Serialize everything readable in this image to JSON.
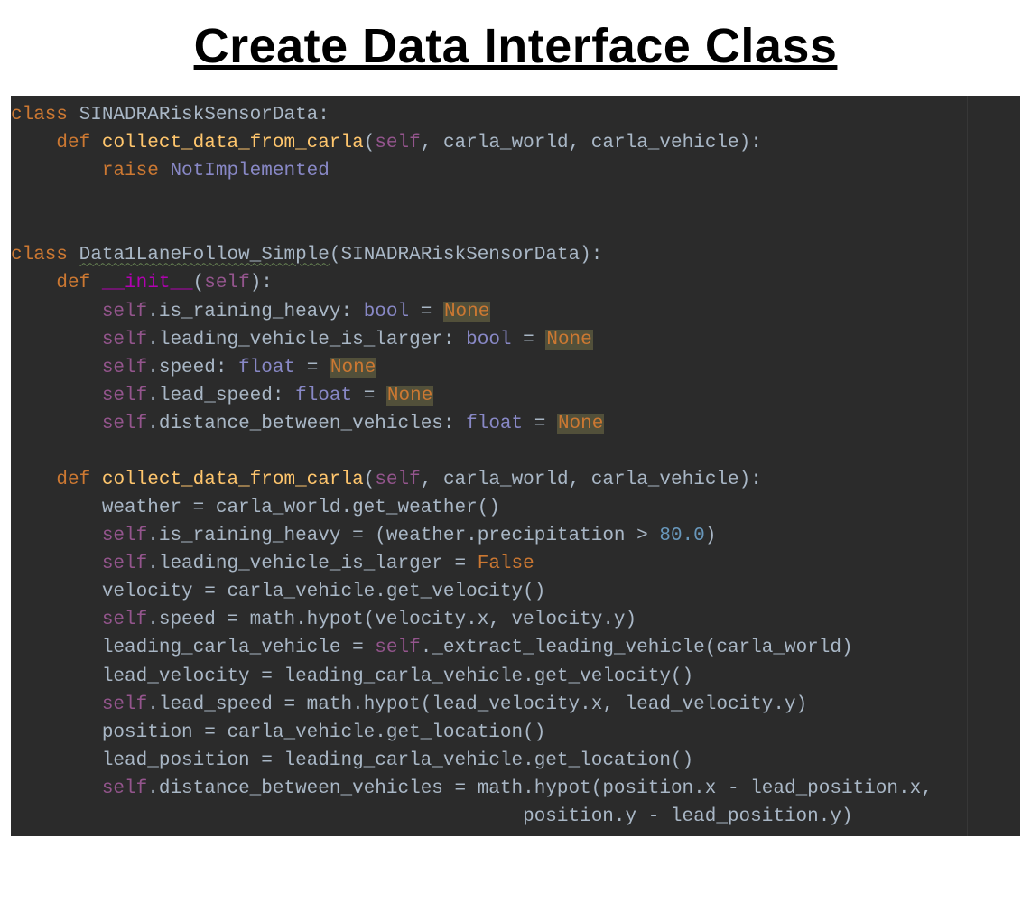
{
  "heading": "Create Data Interface Class",
  "code": {
    "line1": {
      "kw_class": "class",
      "name": "SINADRARiskSensorData",
      "colon": ":"
    },
    "line2": {
      "kw_def": "def",
      "fn": "collect_data_from_carla",
      "p1": "self",
      "p2": "carla_world",
      "p3": "carla_vehicle"
    },
    "line3": {
      "kw_raise": "raise",
      "exc": "NotImplemented"
    },
    "line6": {
      "kw_class": "class",
      "name": "Data1LaneFollow_Simple",
      "base": "SINADRARiskSensorData"
    },
    "line7": {
      "kw_def": "def",
      "fn": "__init__",
      "p1": "self"
    },
    "line8": {
      "self": "self",
      "attr": ".is_raining_heavy: ",
      "t": "bool",
      "eq": " = ",
      "val": "None"
    },
    "line9": {
      "self": "self",
      "attr": ".leading_vehicle_is_larger: ",
      "t": "bool",
      "eq": " = ",
      "val": "None"
    },
    "line10": {
      "self": "self",
      "attr": ".speed: ",
      "t": "float",
      "eq": " = ",
      "val": "None"
    },
    "line11": {
      "self": "self",
      "attr": ".lead_speed: ",
      "t": "float",
      "eq": " = ",
      "val": "None"
    },
    "line12": {
      "self": "self",
      "attr": ".distance_between_vehicles: ",
      "t": "float",
      "eq": " = ",
      "val": "None"
    },
    "line14": {
      "kw_def": "def",
      "fn": "collect_data_from_carla",
      "p1": "self",
      "p2": "carla_world",
      "p3": "carla_vehicle"
    },
    "line15": {
      "txt": "weather = carla_world.get_weather()"
    },
    "line16": {
      "self": "self",
      "txt": ".is_raining_heavy = (weather.precipitation > ",
      "num": "80.0",
      "tail": ")"
    },
    "line17": {
      "self": "self",
      "txt": ".leading_vehicle_is_larger = ",
      "val": "False"
    },
    "line18": {
      "txt": "velocity = carla_vehicle.get_velocity()"
    },
    "line19": {
      "self": "self",
      "txt": ".speed = math.hypot(velocity.x, velocity.y)"
    },
    "line20": {
      "pre": "leading_carla_vehicle = ",
      "self": "self",
      "txt": "._extract_leading_vehicle(carla_world)"
    },
    "line21": {
      "txt": "lead_velocity = leading_carla_vehicle.get_velocity()"
    },
    "line22": {
      "self": "self",
      "txt": ".lead_speed = math.hypot(lead_velocity.x, lead_velocity.y)"
    },
    "line23": {
      "txt": "position = carla_vehicle.get_location()"
    },
    "line24": {
      "txt": "lead_position = leading_carla_vehicle.get_location()"
    },
    "line25": {
      "self": "self",
      "txt": ".distance_between_vehicles = math.hypot(position.x - lead_position.x,"
    },
    "line26": {
      "txt": "                                             position.y - lead_position.y)"
    }
  }
}
